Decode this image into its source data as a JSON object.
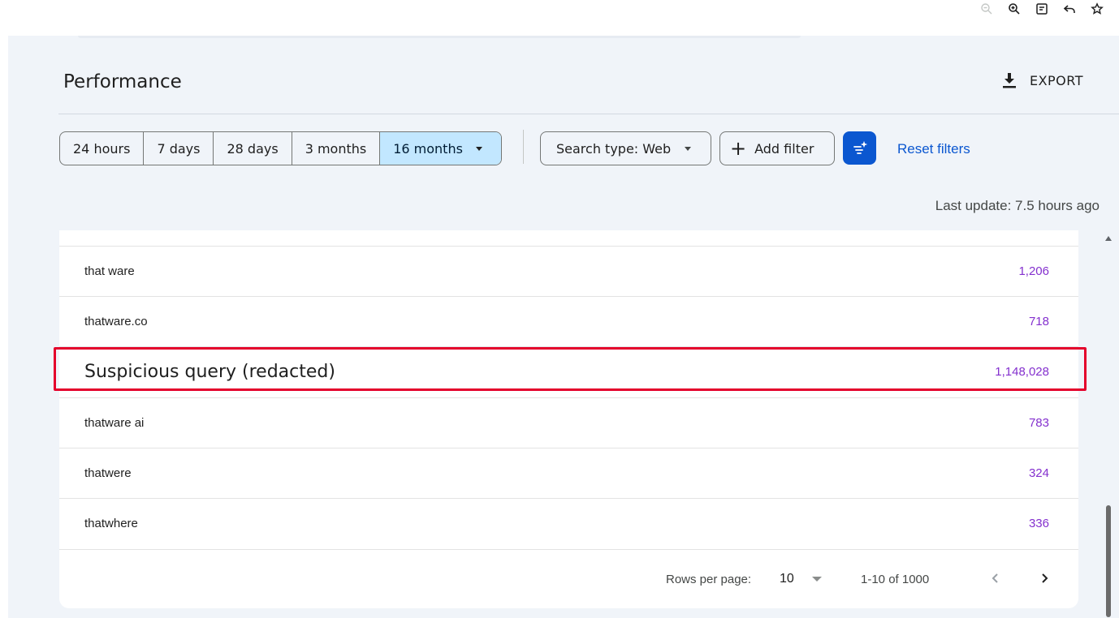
{
  "browser": {
    "icons": [
      "zoom-out-icon",
      "zoom-in-icon",
      "reader-mode-icon",
      "back-icon",
      "bookmark-star-icon"
    ]
  },
  "header": {
    "title": "Performance",
    "export_label": "EXPORT"
  },
  "filters": {
    "date_ranges": [
      {
        "label": "24 hours",
        "active": false
      },
      {
        "label": "7 days",
        "active": false
      },
      {
        "label": "28 days",
        "active": false
      },
      {
        "label": "3 months",
        "active": false
      },
      {
        "label": "16 months",
        "active": true
      }
    ],
    "search_type": "Search type: Web",
    "add_filter": "Add filter",
    "reset_filters": "Reset filters"
  },
  "status": {
    "last_update": "Last update: 7.5 hours ago"
  },
  "table": {
    "rows": [
      {
        "query": "that ware",
        "value": "1,206"
      },
      {
        "query": "thatware.co",
        "value": "718"
      },
      {
        "query": "Suspicious query (redacted)",
        "value": "1,148,028",
        "highlighted": true
      },
      {
        "query": "thatware ai",
        "value": "783"
      },
      {
        "query": "thatwere",
        "value": "324"
      },
      {
        "query": "thatwhere",
        "value": "336"
      }
    ]
  },
  "pagination": {
    "rows_per_page_label": "Rows per page:",
    "rows_per_page_value": "10",
    "range_label": "1-10 of 1000"
  },
  "colors": {
    "accent": "#0b57d0",
    "selected_range": "#c2e7ff",
    "metric_value": "#8430ce",
    "highlight_border": "#e4002b",
    "panel_background": "#f0f4f9"
  }
}
